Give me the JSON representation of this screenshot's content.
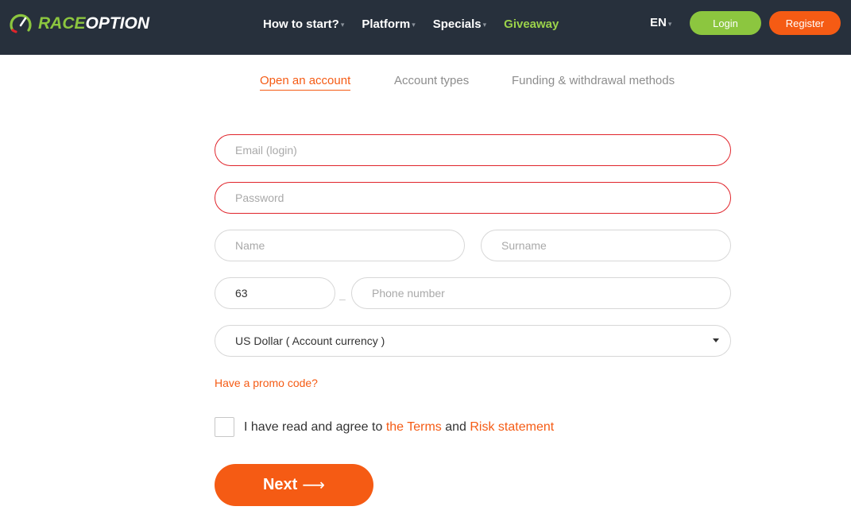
{
  "header": {
    "logo": {
      "part1": "RACE",
      "part2": "OPTION"
    },
    "nav": [
      {
        "label": "How to start?",
        "has_dropdown": true
      },
      {
        "label": "Platform",
        "has_dropdown": true
      },
      {
        "label": "Specials",
        "has_dropdown": true
      },
      {
        "label": "Giveaway",
        "has_dropdown": false
      }
    ],
    "language": "EN",
    "login_label": "Login",
    "register_label": "Register"
  },
  "tabs": [
    {
      "label": "Open an account",
      "active": true
    },
    {
      "label": "Account types",
      "active": false
    },
    {
      "label": "Funding & withdrawal methods",
      "active": false
    }
  ],
  "form": {
    "email_placeholder": "Email (login)",
    "password_placeholder": "Password",
    "name_placeholder": "Name",
    "surname_placeholder": "Surname",
    "phone_code": "63",
    "phone_separator": "–",
    "phone_placeholder": "Phone number",
    "currency_selected": "US Dollar ( Account currency )",
    "promo_link": "Have a promo code?",
    "agree_text": "I have read and agree to",
    "terms_link": "the Terms",
    "and_text": "and",
    "risk_link": "Risk statement",
    "next_label": "Next",
    "next_arrow": "⟶"
  },
  "colors": {
    "header_bg": "#27303c",
    "accent_orange": "#f55b14",
    "accent_green": "#8cc63f",
    "error_red": "#e0242b"
  }
}
